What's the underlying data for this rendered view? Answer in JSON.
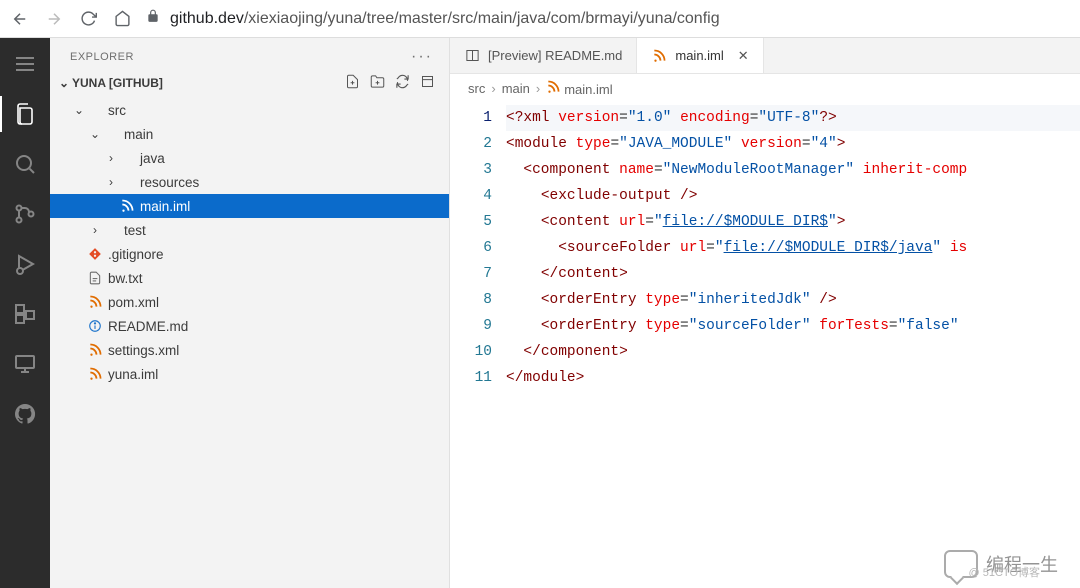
{
  "browser": {
    "host": "github.dev",
    "path": "/xiexiaojing/yuna/tree/master/src/main/java/com/brmayi/yuna/config"
  },
  "sidebar": {
    "title": "EXPLORER",
    "project": "YUNA [GITHUB]",
    "tree": [
      {
        "indent": 1,
        "chev": "v",
        "icon": "",
        "label": "src",
        "kind": "folder"
      },
      {
        "indent": 2,
        "chev": "v",
        "icon": "",
        "label": "main",
        "kind": "folder"
      },
      {
        "indent": 3,
        "chev": ">",
        "icon": "",
        "label": "java",
        "kind": "folder"
      },
      {
        "indent": 3,
        "chev": ">",
        "icon": "",
        "label": "resources",
        "kind": "folder"
      },
      {
        "indent": 3,
        "chev": "",
        "icon": "rss",
        "label": "main.iml",
        "kind": "file",
        "selected": true
      },
      {
        "indent": 2,
        "chev": ">",
        "icon": "",
        "label": "test",
        "kind": "folder"
      },
      {
        "indent": 1,
        "chev": "",
        "icon": "git",
        "label": ".gitignore",
        "kind": "file"
      },
      {
        "indent": 1,
        "chev": "",
        "icon": "txt",
        "label": "bw.txt",
        "kind": "file"
      },
      {
        "indent": 1,
        "chev": "",
        "icon": "rss",
        "label": "pom.xml",
        "kind": "file"
      },
      {
        "indent": 1,
        "chev": "",
        "icon": "info",
        "label": "README.md",
        "kind": "file"
      },
      {
        "indent": 1,
        "chev": "",
        "icon": "rss",
        "label": "settings.xml",
        "kind": "file"
      },
      {
        "indent": 1,
        "chev": "",
        "icon": "rss",
        "label": "yuna.iml",
        "kind": "file"
      }
    ]
  },
  "tabs": [
    {
      "icon": "preview",
      "label": "[Preview] README.md",
      "active": false
    },
    {
      "icon": "rss",
      "label": "main.iml",
      "active": true,
      "closeable": true
    }
  ],
  "breadcrumb": [
    "src",
    "main",
    "main.iml"
  ],
  "code": {
    "lines": [
      {
        "n": 1,
        "html": "<span class='tok-br'>&lt;?</span><span class='tok-pi'>xml</span> <span class='tok-attr'>version</span>=<span class='tok-str'>\"1.0\"</span> <span class='tok-attr'>encoding</span>=<span class='tok-str'>\"UTF-8\"</span><span class='tok-br'>?&gt;</span>"
      },
      {
        "n": 2,
        "html": "<span class='tok-br'>&lt;</span><span class='tok-tag'>module</span> <span class='tok-attr'>type</span>=<span class='tok-str'>\"JAVA_MODULE\"</span> <span class='tok-attr'>version</span>=<span class='tok-str'>\"4\"</span><span class='tok-br'>&gt;</span>"
      },
      {
        "n": 3,
        "html": "  <span class='tok-br'>&lt;</span><span class='tok-tag'>component</span> <span class='tok-attr'>name</span>=<span class='tok-str'>\"NewModuleRootManager\"</span> <span class='tok-attr'>inherit-comp</span>"
      },
      {
        "n": 4,
        "html": "    <span class='tok-br'>&lt;</span><span class='tok-tag'>exclude-output</span> <span class='tok-br'>/&gt;</span>"
      },
      {
        "n": 5,
        "html": "    <span class='tok-br'>&lt;</span><span class='tok-tag'>content</span> <span class='tok-attr'>url</span>=<span class='tok-str'>\"</span><span class='tok-link'>file://$MODULE_DIR$</span><span class='tok-str'>\"</span><span class='tok-br'>&gt;</span>"
      },
      {
        "n": 6,
        "html": "      <span class='tok-br'>&lt;</span><span class='tok-tag'>sourceFolder</span> <span class='tok-attr'>url</span>=<span class='tok-str'>\"</span><span class='tok-link'>file://$MODULE_DIR$/java</span><span class='tok-str'>\"</span> <span class='tok-attr'>is</span>"
      },
      {
        "n": 7,
        "html": "    <span class='tok-br'>&lt;/</span><span class='tok-tag'>content</span><span class='tok-br'>&gt;</span>"
      },
      {
        "n": 8,
        "html": "    <span class='tok-br'>&lt;</span><span class='tok-tag'>orderEntry</span> <span class='tok-attr'>type</span>=<span class='tok-str'>\"inheritedJdk\"</span> <span class='tok-br'>/&gt;</span>"
      },
      {
        "n": 9,
        "html": "    <span class='tok-br'>&lt;</span><span class='tok-tag'>orderEntry</span> <span class='tok-attr'>type</span>=<span class='tok-str'>\"sourceFolder\"</span> <span class='tok-attr'>forTests</span>=<span class='tok-str'>\"false\"</span>"
      },
      {
        "n": 10,
        "html": "  <span class='tok-br'>&lt;/</span><span class='tok-tag'>component</span><span class='tok-br'>&gt;</span>"
      },
      {
        "n": 11,
        "html": "<span class='tok-br'>&lt;/</span><span class='tok-tag'>module</span><span class='tok-br'>&gt;</span>"
      }
    ],
    "active_line": 1
  },
  "watermark": {
    "text": "编程一生",
    "sub": "@ 51CTO博客"
  }
}
